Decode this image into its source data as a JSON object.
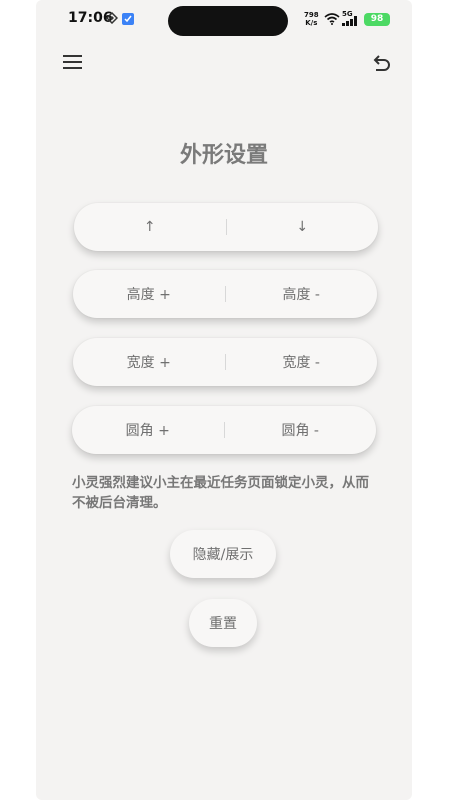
{
  "status_bar": {
    "time": "17:06",
    "net_speed_value": "798",
    "net_speed_unit": "K/s",
    "network": "5G",
    "battery": "98"
  },
  "header": {
    "menu_icon": "hamburger-menu-icon",
    "back_icon": "undo-arrow-icon"
  },
  "page": {
    "title": "外形设置"
  },
  "controls": {
    "row_move": {
      "left": "↑",
      "right": "↓"
    },
    "row_height": {
      "left": "高度 +",
      "right": "高度 -"
    },
    "row_width": {
      "left": "宽度 +",
      "right": "宽度 -"
    },
    "row_radius": {
      "left": "圆角 +",
      "right": "圆角 -"
    }
  },
  "notice": "小灵强烈建议小主在最近任务页面锁定小灵，从而不被后台清理。",
  "buttons": {
    "toggle": "隐藏/展示",
    "reset": "重置"
  },
  "colors": {
    "background": "#f4f3f2",
    "button_bg": "#f8f7f6",
    "text_gray": "#707070",
    "battery_green": "#4cd964"
  }
}
